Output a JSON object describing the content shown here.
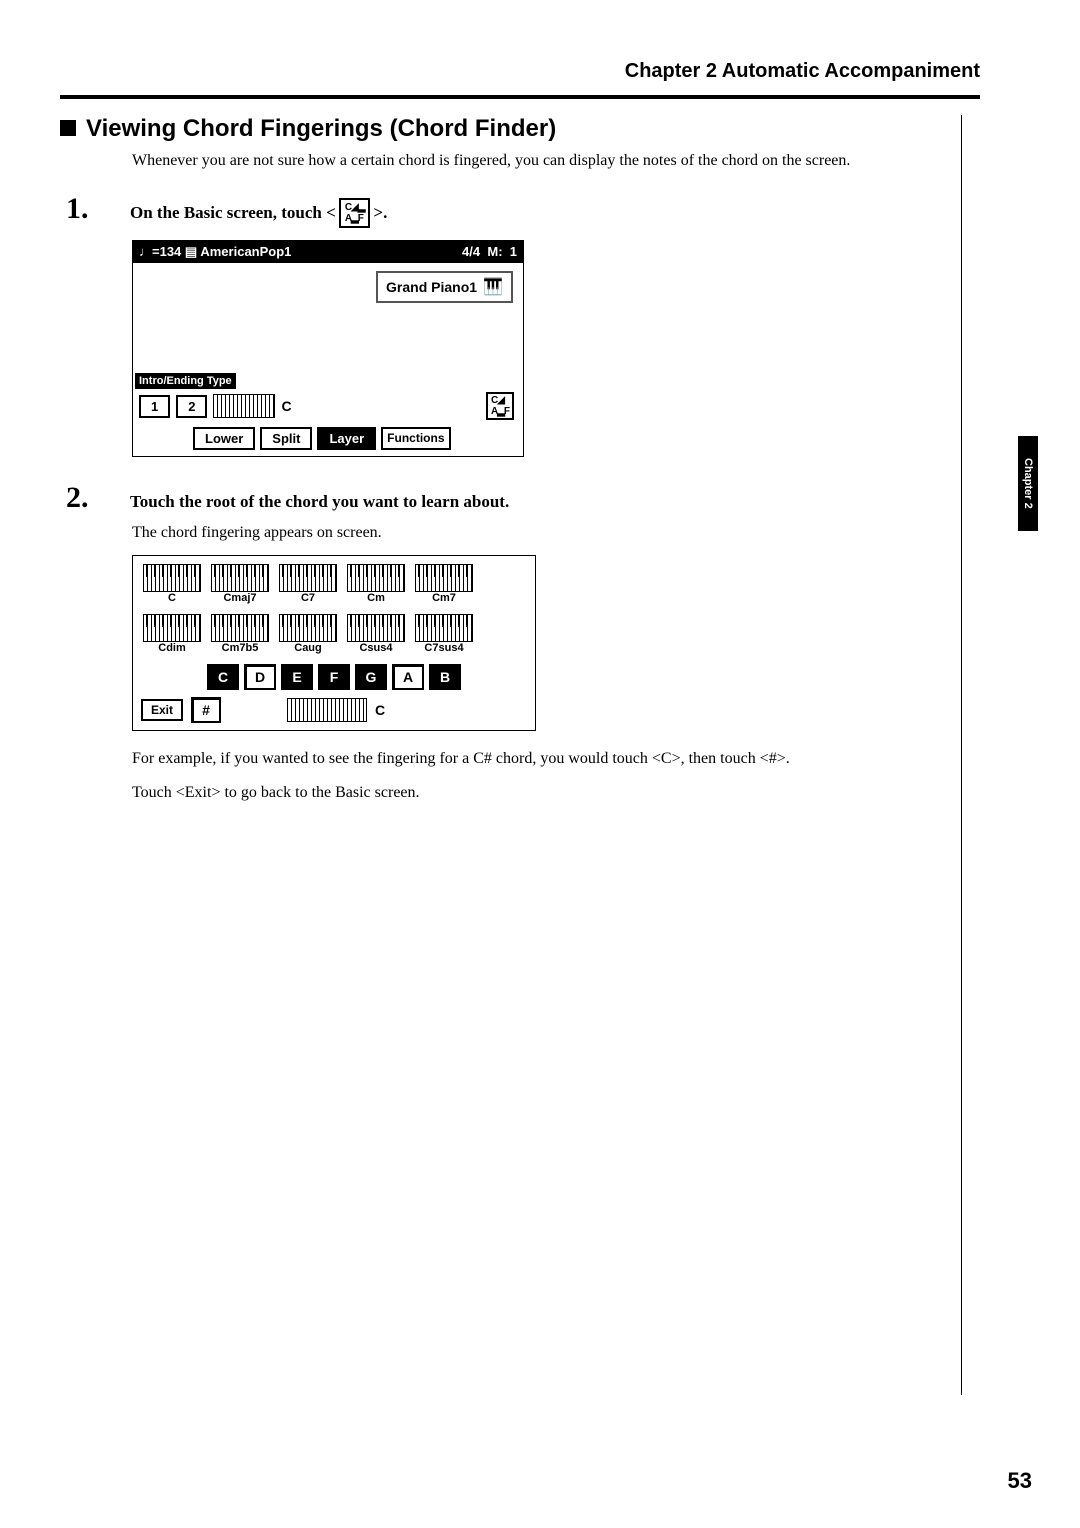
{
  "chapter_header": "Chapter 2  Automatic Accompaniment",
  "section_title": "Viewing Chord Fingerings (Chord Finder)",
  "intro": "Whenever you are not sure how a certain chord is fingered, you can display the notes of the chord on the screen.",
  "step1": {
    "num": "1",
    "text_before": "On the Basic screen, touch <",
    "text_after": ">."
  },
  "scr1": {
    "tempo": "♩=134",
    "style_icon": "🎵",
    "style_name": "AmericanPop1",
    "time_sig": "4/4",
    "meas_label": "M:",
    "meas_num": "1",
    "tone_name": "Grand Piano1",
    "intro_label": "Intro/Ending Type",
    "intro_1": "1",
    "intro_2": "2",
    "chord_c": "C",
    "btn_lower": "Lower",
    "btn_split": "Split",
    "btn_layer": "Layer",
    "btn_functions": "Functions"
  },
  "step2": {
    "num": "2",
    "text": "Touch the root of the chord you want to learn about."
  },
  "step2_body": "The chord fingering appears on screen.",
  "scr2": {
    "row1": [
      "C",
      "Cmaj7",
      "C7",
      "Cm",
      "Cm7"
    ],
    "row2": [
      "Cdim",
      "Cm7b5",
      "Caug",
      "Csus4",
      "C7sus4"
    ],
    "roots": [
      "C",
      "D",
      "E",
      "F",
      "G",
      "A",
      "B"
    ],
    "exit": "Exit",
    "sharp": "#",
    "chord_c": "C"
  },
  "example": "For example, if you wanted to see the fingering for a C# chord, you would touch <C>, then touch <#>.",
  "exit_text": "Touch <Exit> to go back to the Basic screen.",
  "side_tab": "Chapter 2",
  "page_num": "53"
}
